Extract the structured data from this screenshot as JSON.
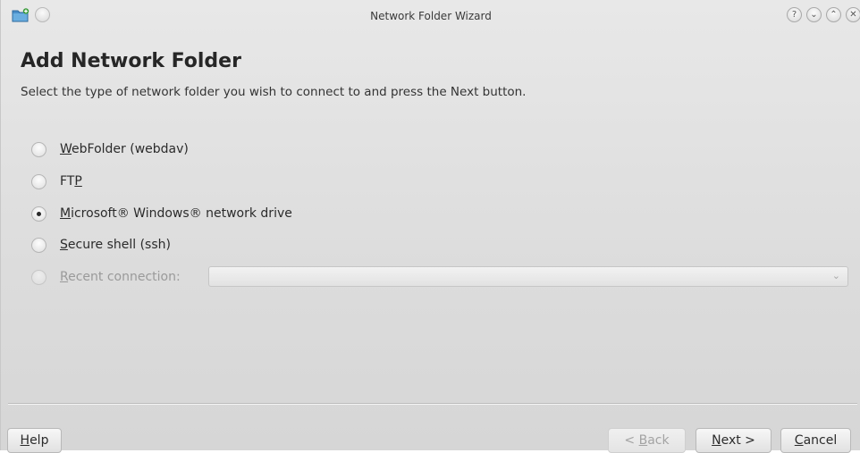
{
  "window": {
    "title": "Network Folder Wizard",
    "controls": {
      "help": "?",
      "minimize": "⌄",
      "maximize": "⌃",
      "close": "✕"
    }
  },
  "page": {
    "title": "Add Network Folder",
    "subtitle": "Select the type of network folder you wish to connect to and press the Next button."
  },
  "options": [
    {
      "mnemonic": "W",
      "rest": "ebFolder (webdav)",
      "checked": false,
      "enabled": true
    },
    {
      "mnemonic_prefix": "FT",
      "mnemonic": "P",
      "checked": false,
      "enabled": true
    },
    {
      "mnemonic": "M",
      "rest": "icrosoft® Windows® network drive",
      "checked": true,
      "enabled": true
    },
    {
      "mnemonic": "S",
      "rest": "ecure shell (ssh)",
      "checked": false,
      "enabled": true
    },
    {
      "mnemonic": "R",
      "rest": "ecent connection:",
      "checked": false,
      "enabled": false
    }
  ],
  "recent_combo": {
    "value": "",
    "icon": "chevron-down-icon"
  },
  "buttons": {
    "help": {
      "mnemonic": "H",
      "rest": "elp"
    },
    "back": {
      "prefix": "< ",
      "mnemonic": "B",
      "rest": "ack",
      "enabled": false
    },
    "next": {
      "mnemonic": "N",
      "rest": "ext >"
    },
    "cancel": {
      "mnemonic": "C",
      "rest": "ancel"
    }
  },
  "colors": {
    "background": "#dcdcdc",
    "title_text": "#262626",
    "disabled_text": "#9a9a9a"
  }
}
